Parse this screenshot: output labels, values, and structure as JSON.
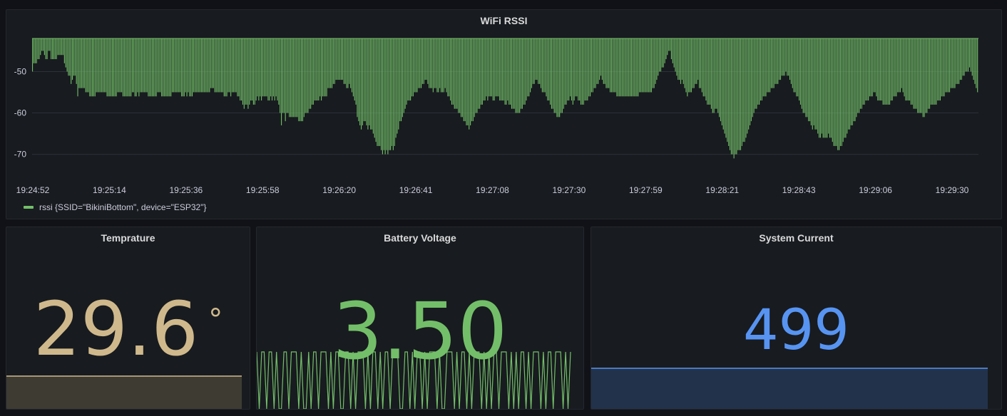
{
  "colors": {
    "green": "#73bf69",
    "temp": "#cfb98c",
    "blue": "#5794f2",
    "grid": "#2c3039",
    "text": "#ccccdc"
  },
  "wifi_panel": {
    "title": "WiFi RSSI",
    "legend": "rssi {SSID=\"BikiniBottom\", device=\"ESP32\"}"
  },
  "temp_panel": {
    "title": "Temprature",
    "value": "29.6",
    "unit": "°"
  },
  "battery_panel": {
    "title": "Battery Voltage",
    "value": "3.50"
  },
  "current_panel": {
    "title": "System Current",
    "value": "499"
  },
  "chart_data": {
    "type": "bar",
    "series": [
      {
        "name": "rssi {SSID=\"BikiniBottom\", device=\"ESP32\"}"
      }
    ],
    "y_ticks": [
      -50,
      -60,
      -70
    ],
    "ylim": [
      -73,
      -42
    ],
    "bar_baseline": -42,
    "x_ticks": [
      "19:24:52",
      "19:25:14",
      "19:25:36",
      "19:25:58",
      "19:26:20",
      "19:26:41",
      "19:27:08",
      "19:27:30",
      "19:27:59",
      "19:28:21",
      "19:28:43",
      "19:29:06",
      "19:29:30"
    ],
    "values": [
      -50,
      -48,
      -48,
      -48,
      -47,
      -47,
      -46,
      -45,
      -45,
      -46,
      -47,
      -47,
      -45,
      -45,
      -47,
      -47,
      -47,
      -47,
      -47,
      -46,
      -46,
      -46,
      -46,
      -46,
      -48,
      -49,
      -50,
      -51,
      -51,
      -53,
      -52,
      -51,
      -51,
      -53,
      -56,
      -54,
      -54,
      -54,
      -54,
      -54,
      -55,
      -55,
      -55,
      -56,
      -56,
      -56,
      -56,
      -56,
      -55,
      -55,
      -55,
      -55,
      -55,
      -55,
      -55,
      -55,
      -56,
      -56,
      -56,
      -56,
      -56,
      -56,
      -56,
      -56,
      -55,
      -55,
      -55,
      -55,
      -56,
      -56,
      -56,
      -56,
      -56,
      -56,
      -56,
      -55,
      -55,
      -56,
      -56,
      -55,
      -56,
      -55,
      -55,
      -55,
      -55,
      -55,
      -55,
      -56,
      -56,
      -56,
      -56,
      -56,
      -56,
      -56,
      -55,
      -55,
      -55,
      -56,
      -56,
      -56,
      -56,
      -56,
      -56,
      -56,
      -56,
      -55,
      -55,
      -55,
      -55,
      -55,
      -55,
      -55,
      -56,
      -56,
      -56,
      -55,
      -56,
      -55,
      -56,
      -56,
      -56,
      -55,
      -55,
      -55,
      -55,
      -55,
      -55,
      -55,
      -55,
      -55,
      -55,
      -55,
      -55,
      -55,
      -54,
      -54,
      -54,
      -55,
      -55,
      -55,
      -55,
      -55,
      -55,
      -55,
      -56,
      -56,
      -56,
      -55,
      -55,
      -56,
      -55,
      -55,
      -55,
      -55,
      -56,
      -56,
      -57,
      -57,
      -58,
      -59,
      -58,
      -58,
      -59,
      -58,
      -57,
      -57,
      -58,
      -58,
      -57,
      -56,
      -57,
      -56,
      -57,
      -56,
      -56,
      -56,
      -56,
      -57,
      -57,
      -56,
      -57,
      -56,
      -57,
      -56,
      -57,
      -58,
      -60,
      -63,
      -60,
      -60,
      -62,
      -60,
      -60,
      -61,
      -61,
      -61,
      -61,
      -61,
      -61,
      -61,
      -62,
      -62,
      -62,
      -62,
      -61,
      -60,
      -60,
      -60,
      -59,
      -59,
      -58,
      -58,
      -57,
      -57,
      -57,
      -57,
      -56,
      -57,
      -56,
      -56,
      -56,
      -56,
      -54,
      -54,
      -54,
      -54,
      -53,
      -53,
      -52,
      -52,
      -52,
      -52,
      -52,
      -52,
      -53,
      -53,
      -54,
      -54,
      -53,
      -54,
      -55,
      -56,
      -57,
      -58,
      -61,
      -62,
      -63,
      -64,
      -63,
      -62,
      -62,
      -63,
      -64,
      -63,
      -64,
      -64,
      -65,
      -66,
      -67,
      -68,
      -68,
      -68,
      -69,
      -70,
      -69,
      -70,
      -69,
      -70,
      -69,
      -69,
      -68,
      -69,
      -68,
      -66,
      -65,
      -64,
      -62,
      -62,
      -61,
      -60,
      -59,
      -58,
      -57,
      -57,
      -57,
      -56,
      -56,
      -55,
      -55,
      -55,
      -54,
      -54,
      -54,
      -53,
      -53,
      -52,
      -52,
      -53,
      -54,
      -54,
      -54,
      -55,
      -54,
      -54,
      -55,
      -55,
      -54,
      -55,
      -55,
      -55,
      -54,
      -55,
      -56,
      -56,
      -57,
      -58,
      -58,
      -59,
      -59,
      -59,
      -60,
      -60,
      -61,
      -61,
      -62,
      -62,
      -63,
      -63,
      -64,
      -63,
      -62,
      -62,
      -61,
      -60,
      -60,
      -59,
      -59,
      -58,
      -58,
      -57,
      -57,
      -56,
      -57,
      -56,
      -56,
      -56,
      -57,
      -57,
      -56,
      -56,
      -56,
      -57,
      -57,
      -57,
      -57,
      -58,
      -58,
      -57,
      -58,
      -58,
      -59,
      -59,
      -59,
      -60,
      -60,
      -60,
      -60,
      -59,
      -59,
      -58,
      -58,
      -57,
      -56,
      -56,
      -55,
      -54,
      -53,
      -53,
      -52,
      -52,
      -53,
      -53,
      -54,
      -55,
      -55,
      -55,
      -56,
      -57,
      -57,
      -58,
      -59,
      -59,
      -60,
      -60,
      -61,
      -61,
      -61,
      -60,
      -60,
      -59,
      -58,
      -58,
      -57,
      -57,
      -56,
      -57,
      -58,
      -57,
      -56,
      -56,
      -57,
      -57,
      -58,
      -58,
      -58,
      -57,
      -57,
      -57,
      -56,
      -56,
      -55,
      -55,
      -54,
      -54,
      -53,
      -53,
      -52,
      -51,
      -52,
      -53,
      -53,
      -54,
      -54,
      -54,
      -55,
      -55,
      -55,
      -55,
      -55,
      -56,
      -56,
      -56,
      -56,
      -56,
      -56,
      -56,
      -56,
      -56,
      -56,
      -56,
      -56,
      -56,
      -56,
      -56,
      -56,
      -56,
      -55,
      -55,
      -55,
      -55,
      -55,
      -55,
      -55,
      -55,
      -55,
      -55,
      -54,
      -54,
      -53,
      -52,
      -51,
      -50,
      -50,
      -49,
      -49,
      -48,
      -47,
      -46,
      -45,
      -45,
      -47,
      -48,
      -49,
      -50,
      -51,
      -52,
      -52,
      -53,
      -52,
      -53,
      -54,
      -55,
      -56,
      -55,
      -55,
      -55,
      -54,
      -54,
      -53,
      -53,
      -52,
      -54,
      -54,
      -55,
      -56,
      -56,
      -57,
      -58,
      -58,
      -58,
      -59,
      -60,
      -60,
      -59,
      -59,
      -60,
      -61,
      -62,
      -63,
      -64,
      -65,
      -66,
      -67,
      -68,
      -69,
      -70,
      -70,
      -71,
      -70,
      -70,
      -69,
      -69,
      -69,
      -68,
      -67,
      -67,
      -66,
      -65,
      -64,
      -63,
      -62,
      -61,
      -60,
      -59,
      -59,
      -58,
      -58,
      -57,
      -57,
      -56,
      -56,
      -56,
      -55,
      -55,
      -55,
      -54,
      -54,
      -54,
      -53,
      -53,
      -53,
      -52,
      -52,
      -51,
      -51,
      -51,
      -50,
      -51,
      -51,
      -52,
      -53,
      -54,
      -55,
      -55,
      -56,
      -56,
      -57,
      -58,
      -59,
      -60,
      -60,
      -61,
      -61,
      -62,
      -62,
      -63,
      -64,
      -63,
      -64,
      -64,
      -65,
      -66,
      -66,
      -65,
      -66,
      -66,
      -66,
      -66,
      -65,
      -66,
      -66,
      -67,
      -68,
      -68,
      -68,
      -69,
      -69,
      -68,
      -68,
      -67,
      -66,
      -66,
      -65,
      -64,
      -64,
      -63,
      -63,
      -62,
      -62,
      -61,
      -60,
      -60,
      -59,
      -59,
      -58,
      -58,
      -57,
      -57,
      -57,
      -56,
      -56,
      -56,
      -55,
      -55,
      -56,
      -57,
      -57,
      -57,
      -57,
      -58,
      -58,
      -58,
      -58,
      -58,
      -58,
      -57,
      -57,
      -56,
      -56,
      -56,
      -55,
      -55,
      -55,
      -54,
      -55,
      -56,
      -57,
      -57,
      -57,
      -57,
      -58,
      -58,
      -59,
      -59,
      -59,
      -60,
      -60,
      -60,
      -60,
      -61,
      -61,
      -60,
      -60,
      -59,
      -59,
      -58,
      -58,
      -58,
      -58,
      -58,
      -57,
      -57,
      -57,
      -56,
      -56,
      -56,
      -55,
      -55,
      -55,
      -55,
      -54,
      -54,
      -54,
      -54,
      -53,
      -53,
      -53,
      -52,
      -52,
      -51,
      -51,
      -50,
      -50,
      -50,
      -49,
      -50,
      -51,
      -52,
      -53,
      -54,
      -55
    ]
  },
  "battery_spark": {
    "values": [
      1,
      0,
      1,
      1,
      0,
      1,
      1,
      0,
      1,
      0,
      0,
      1,
      1,
      0,
      1,
      1,
      1,
      0,
      1,
      0,
      0,
      1,
      0,
      1,
      1,
      0,
      1,
      1,
      1,
      0,
      1,
      0,
      1,
      1,
      0,
      0,
      1,
      1,
      0,
      1,
      0,
      1,
      1,
      1,
      0,
      1,
      0,
      1,
      1,
      0,
      1,
      0,
      1,
      1,
      0,
      1,
      1,
      1,
      0,
      0,
      1,
      1,
      0,
      1,
      0,
      1,
      1,
      0,
      1,
      0,
      1,
      1,
      1,
      0,
      1,
      0,
      0,
      1,
      1,
      1,
      0,
      1,
      0,
      1,
      1,
      0,
      1,
      0,
      1,
      1,
      1,
      0,
      1,
      0,
      1,
      0,
      1,
      1,
      0,
      1,
      1,
      1,
      0,
      1,
      0,
      1,
      0,
      1,
      1,
      0,
      1,
      0,
      1,
      1,
      1,
      0,
      1,
      0,
      1,
      1,
      0,
      1,
      1,
      1,
      0,
      1,
      0,
      1
    ]
  }
}
